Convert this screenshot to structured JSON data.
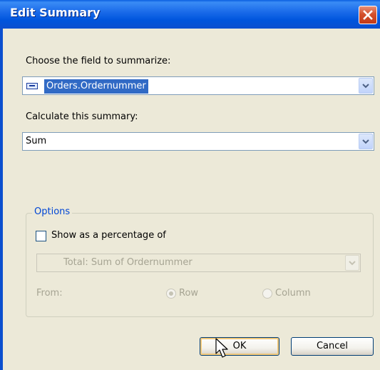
{
  "dialog": {
    "title": "Edit Summary"
  },
  "field_section": {
    "label": "Choose the field to summarize:",
    "selected_field": "Orders.Ordernummer"
  },
  "summary_section": {
    "label": "Calculate this summary:",
    "selected_value": "Sum"
  },
  "options": {
    "legend": "Options",
    "show_percentage_label": "Show as a percentage of",
    "show_percentage_checked": false,
    "percentage_of_value": "Total: Sum of Ordernummer",
    "from_label": "From:",
    "row_label": "Row",
    "column_label": "Column"
  },
  "buttons": {
    "ok_label": "OK",
    "cancel_label": "Cancel"
  },
  "colors": {
    "titlebar": "#0055dd",
    "selection": "#316ac5",
    "legend_text": "#0046d5",
    "disabled_text": "#a6a493"
  },
  "icons": {
    "close": "close-icon",
    "field": "database-field-icon",
    "dropdown": "chevron-down-icon",
    "cursor": "arrow-cursor-icon"
  }
}
